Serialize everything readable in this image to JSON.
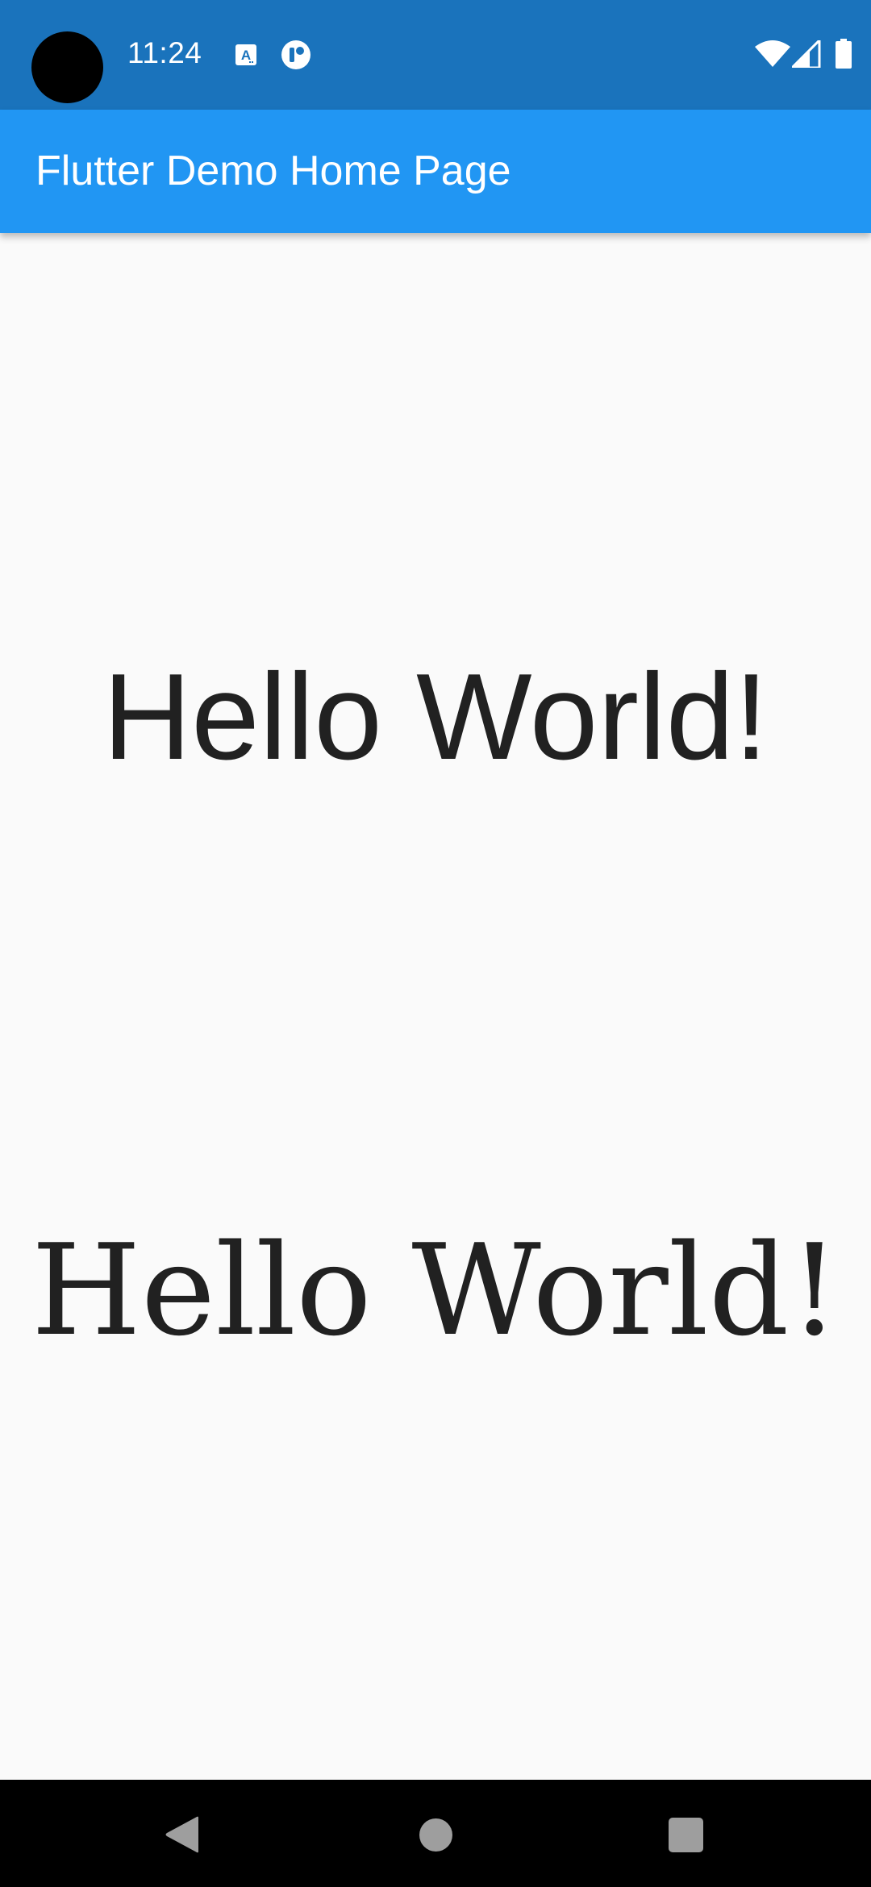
{
  "status_bar": {
    "time": "11:24",
    "background_color": "#1a73bc",
    "notification_icons": [
      "text-a-notification-icon",
      "r-app-notification-icon"
    ],
    "system_icons": [
      "wifi-icon",
      "cell-signal-icon",
      "battery-icon"
    ]
  },
  "app_bar": {
    "title": "Flutter Demo Home Page",
    "background_color": "#2196f3"
  },
  "content": {
    "greeting_sans": "Hello World!",
    "greeting_serif": "Hello World!",
    "text_color": "#212121"
  },
  "nav_bar": {
    "buttons": [
      "back-icon",
      "home-icon",
      "recents-icon"
    ]
  }
}
